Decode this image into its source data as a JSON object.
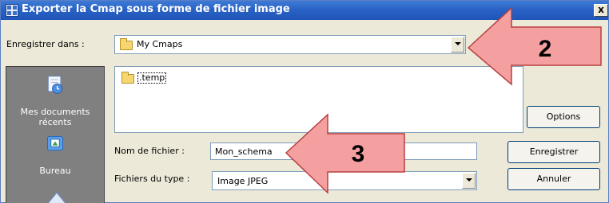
{
  "window": {
    "title": "Exporter la Cmap sous forme de fichier image",
    "close_label": "x"
  },
  "save_in": {
    "label": "Enregistrer dans :",
    "value": "My Cmaps"
  },
  "places": [
    {
      "label": "Mes documents récents",
      "icon": "recent-documents-icon"
    },
    {
      "label": "Bureau",
      "icon": "desktop-icon"
    }
  ],
  "files": [
    {
      "name": ".temp",
      "icon": "folder-icon"
    }
  ],
  "filename": {
    "label": "Nom de fichier :",
    "value": "Mon_schema"
  },
  "filetype": {
    "label": "Fichiers du type :",
    "value": "Image JPEG"
  },
  "buttons": {
    "options": "Options",
    "save": "Enregistrer",
    "cancel": "Annuler"
  },
  "callouts": [
    {
      "number": "2",
      "color": "#f5a0a0"
    },
    {
      "number": "3",
      "color": "#f5a0a0"
    }
  ]
}
